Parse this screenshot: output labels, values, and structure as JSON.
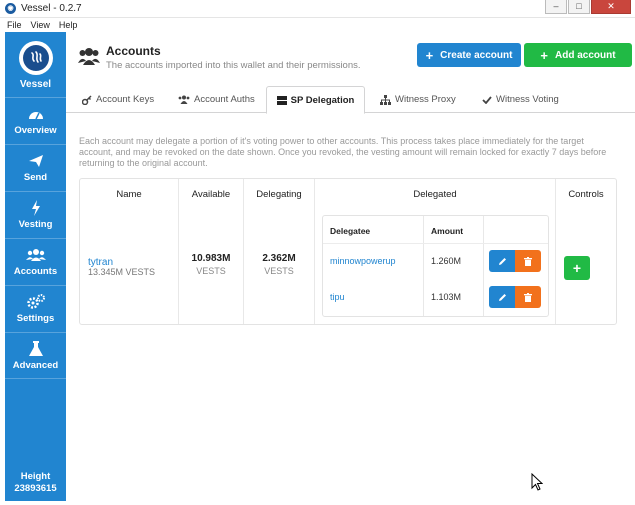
{
  "window": {
    "title": "Vessel - 0.2.7",
    "icon": "vessel-logo-icon"
  },
  "menu": [
    "File",
    "View",
    "Help"
  ],
  "sidebar": {
    "brand": "Vessel",
    "items": [
      {
        "label": "Overview",
        "icon": "dashboard-icon"
      },
      {
        "label": "Send",
        "icon": "paper-plane-icon"
      },
      {
        "label": "Vesting",
        "icon": "lightning-icon"
      },
      {
        "label": "Accounts",
        "icon": "users-icon"
      },
      {
        "label": "Settings",
        "icon": "gears-icon"
      },
      {
        "label": "Advanced",
        "icon": "flask-icon"
      }
    ],
    "height_label": "Height",
    "height_value": "23893615"
  },
  "header": {
    "title": "Accounts",
    "subtitle": "The accounts imported into this wallet and their permissions.",
    "create_label": "Create account",
    "add_label": "Add account"
  },
  "tabs": [
    {
      "label": "Account Keys",
      "icon": "key-icon"
    },
    {
      "label": "Account Auths",
      "icon": "users-icon"
    },
    {
      "label": "SP Delegation",
      "icon": "server-icon",
      "active": true
    },
    {
      "label": "Witness Proxy",
      "icon": "sitemap-icon"
    },
    {
      "label": "Witness Voting",
      "icon": "checkmark-icon"
    }
  ],
  "description": "Each account may delegate a portion of it's voting power to other accounts. This process takes place immediately for the target account, and may be revoked on the date shown. Once you revoked, the vesting amount will remain locked for exactly 7 days before returning to the original account.",
  "table": {
    "headers": {
      "name": "Name",
      "available": "Available",
      "delegating": "Delegating",
      "delegated": "Delegated",
      "controls": "Controls"
    },
    "row": {
      "name": "tytran",
      "vests_amount": "13.345M",
      "vests_unit": "VESTS",
      "available": "10.983M",
      "available_unit": "VESTS",
      "delegating": "2.362M",
      "delegating_unit": "VESTS"
    },
    "delegated": {
      "headers": {
        "delegatee": "Delegatee",
        "amount": "Amount"
      },
      "rows": [
        {
          "delegatee": "minnowpowerup",
          "amount": "1.260M"
        },
        {
          "delegatee": "tipu",
          "amount": "1.103M"
        }
      ]
    }
  },
  "colors": {
    "primary": "#2185d0",
    "positive": "#21ba45",
    "warning": "#f2711c"
  }
}
